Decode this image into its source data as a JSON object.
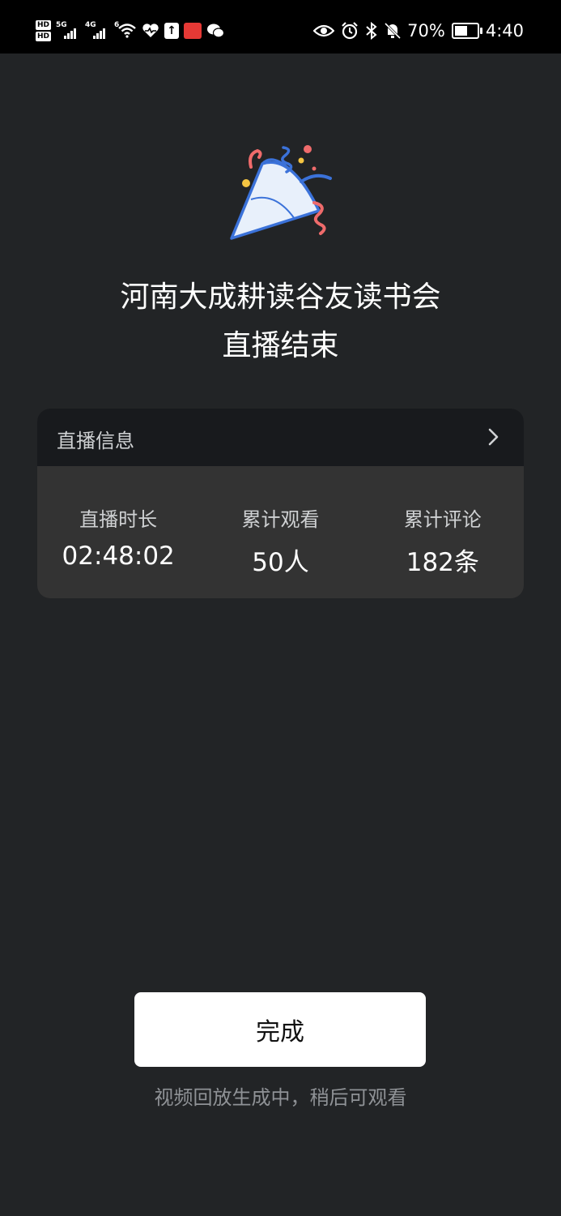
{
  "status_bar": {
    "hd1": "HD",
    "hd2": "HD",
    "net1": "5G",
    "net2": "4G",
    "net3": "6",
    "battery_text": "70%",
    "battery_level": 0.7,
    "time": "4:40"
  },
  "illustration": {
    "icon": "party-popper-icon"
  },
  "title": {
    "line1": "河南大成耕读谷友读书会",
    "line2": "直播结束"
  },
  "info_card": {
    "header": "直播信息",
    "stats": [
      {
        "label": "直播时长",
        "value": "02:48:02"
      },
      {
        "label": "累计观看",
        "value": "50人"
      },
      {
        "label": "累计评论",
        "value": "182条"
      }
    ]
  },
  "done_button": {
    "label": "完成"
  },
  "hint": "视频回放生成中，稍后可观看",
  "colors": {
    "background": "#222426",
    "card": "#333333",
    "card_header": "#181a1d",
    "button": "#ffffff",
    "hint_text": "#8f9296"
  }
}
